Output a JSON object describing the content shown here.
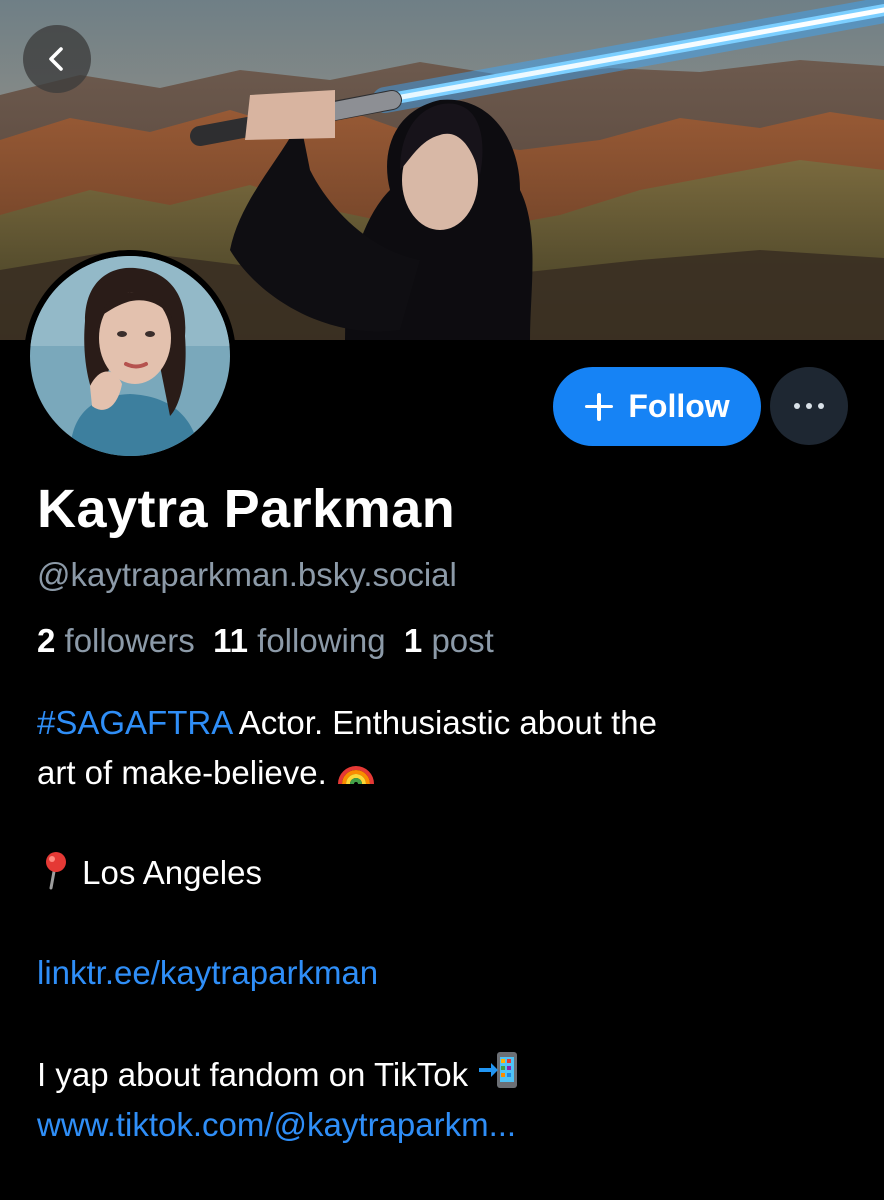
{
  "profile": {
    "display_name": "Kaytra Parkman",
    "handle": "@kaytraparkman.bsky.social"
  },
  "actions": {
    "follow_label": "Follow"
  },
  "stats": {
    "followers_count": "2",
    "followers_label": "followers",
    "following_count": "11",
    "following_label": "following",
    "posts_count": "1",
    "posts_label": "post"
  },
  "bio": {
    "hashtag": "#SAGAFTRA",
    "line1_text": " Actor. Enthusiastic about the",
    "line2_text": "art of make-believe.",
    "location": "Los Angeles",
    "link1": "linktr.ee/kaytraparkman",
    "tiktok_text": "I yap about fandom on TikTok",
    "link2": "www.tiktok.com/@kaytraparkm..."
  },
  "icons": {
    "back": "chevron-left-icon",
    "follow": "plus-icon",
    "more": "ellipsis-icon",
    "rainbow": "rainbow-emoji",
    "pin": "round-pushpin-emoji",
    "phone": "mobile-phone-arrow-emoji"
  },
  "colors": {
    "accent": "#1683f5",
    "link": "#2f8ef7",
    "muted": "#8c9aa8",
    "background": "#000000"
  }
}
